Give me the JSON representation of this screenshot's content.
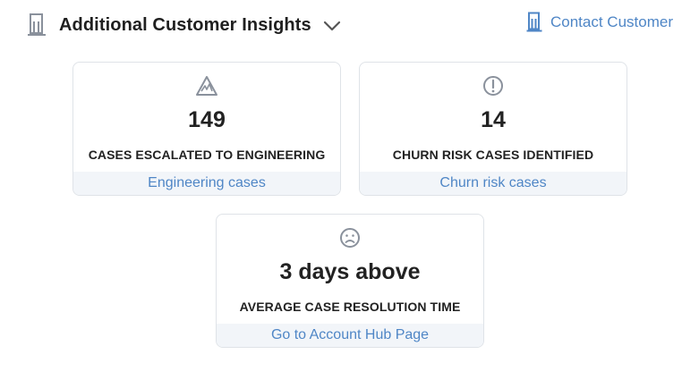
{
  "header": {
    "title": "Additional Customer Insights",
    "icon": "building-icon",
    "toggle_icon": "chevron-down-icon",
    "contact_label": "Contact Customer",
    "contact_icon": "building-icon"
  },
  "cards": [
    {
      "icon": "warning-triangle-icon",
      "value": "149",
      "label": "CASES ESCALATED TO ENGINEERING",
      "link": "Engineering cases"
    },
    {
      "icon": "exclamation-circle-icon",
      "value": "14",
      "label": "CHURN RISK CASES IDENTIFIED",
      "link": "Churn risk cases"
    },
    {
      "icon": "frown-face-icon",
      "value": "3 days above",
      "label": "AVERAGE CASE RESOLUTION TIME",
      "link": "Go to Account Hub Page"
    }
  ],
  "colors": {
    "accent": "#4f86c6",
    "icon_gray": "#8a919c",
    "card_border": "#dfe3e8",
    "link_bg": "#f2f5f9",
    "text": "#222222"
  }
}
